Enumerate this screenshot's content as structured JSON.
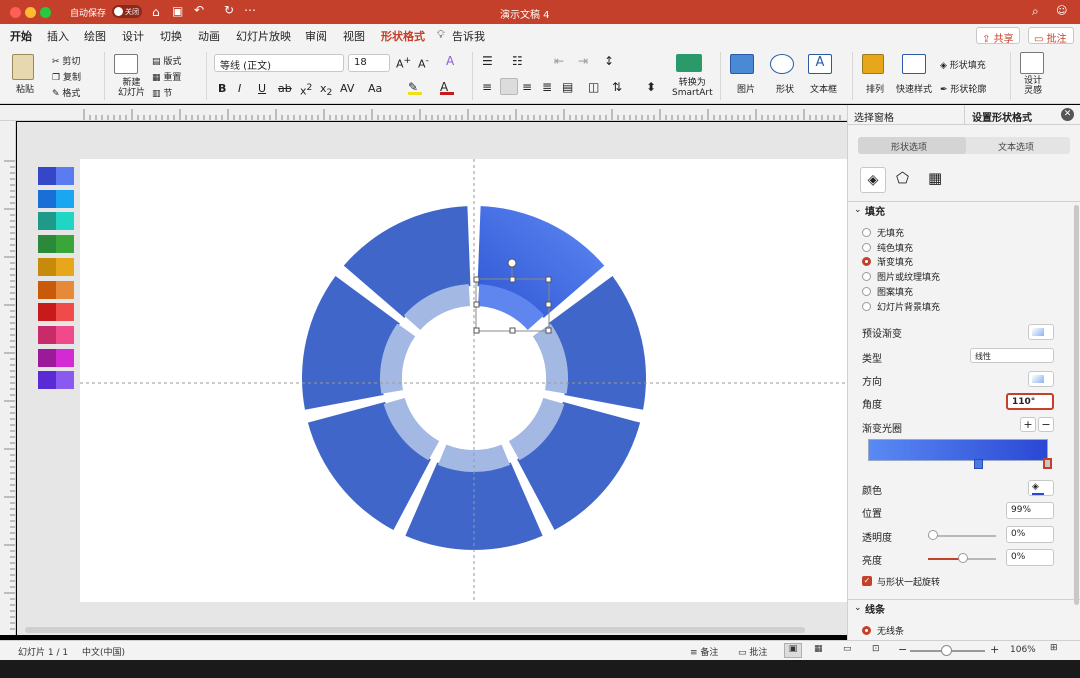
{
  "titlebar": {
    "autosave_label": "自动保存",
    "autosave_state": "关闭",
    "doc_title": "演示文稿 4"
  },
  "tabs": [
    "开始",
    "插入",
    "绘图",
    "设计",
    "切换",
    "动画",
    "幻灯片放映",
    "审阅",
    "视图",
    "形状格式",
    "告诉我"
  ],
  "tab_active": "形状格式",
  "share": {
    "share_label": "共享",
    "comment_label": "批注"
  },
  "ribbon": {
    "paste": "粘贴",
    "cut": "剪切",
    "copy": "复制",
    "format": "格式",
    "new_slide_l1": "新建",
    "new_slide_l2": "幻灯片",
    "layout": "版式",
    "reset": "重置",
    "section": "节",
    "font_name": "等线 (正文)",
    "font_size": "18",
    "convert_l1": "转换为",
    "convert_l2": "SmartArt",
    "picture": "图片",
    "shape": "形状",
    "textbox": "文本框",
    "arrange": "排列",
    "quick_styles": "快速样式",
    "shape_fill": "形状填充",
    "shape_outline": "形状轮廓",
    "designer_l1": "设计",
    "designer_l2": "灵感"
  },
  "pane": {
    "tab_selection": "选择窗格",
    "tab_format": "设置形状格式",
    "sub_shape": "形状选项",
    "sub_text": "文本选项",
    "fill_header": "填充",
    "fill_options": [
      "无填充",
      "纯色填充",
      "渐变填充",
      "图片或纹理填充",
      "图案填充",
      "幻灯片背景填充"
    ],
    "fill_selected": 2,
    "preset_gradient": "预设渐变",
    "type_label": "类型",
    "type_value": "线性",
    "direction_label": "方向",
    "angle_label": "角度",
    "angle_value": "110°",
    "stops_label": "渐变光圈",
    "color_label": "颜色",
    "position_label": "位置",
    "position_value": "99%",
    "transparency_label": "透明度",
    "transparency_value": "0%",
    "brightness_label": "亮度",
    "brightness_value": "0%",
    "rotate_with_shape": "与形状一起旋转",
    "line_header": "线条",
    "no_line": "无线条"
  },
  "swatches": [
    [
      "#3547c8",
      "#5b7bf0"
    ],
    [
      "#1a6fd6",
      "#1aa6f0"
    ],
    [
      "#1f9a8a",
      "#1fd6c4"
    ],
    [
      "#2a8a3a",
      "#3aa63a"
    ],
    [
      "#c88a0a",
      "#e6a81a"
    ],
    [
      "#c85a0a",
      "#e68a3a"
    ],
    [
      "#c81a1a",
      "#f04a4a"
    ],
    [
      "#c82a6a",
      "#f04a8a"
    ],
    [
      "#9a1a9a",
      "#d42ad4"
    ],
    [
      "#5a2ad4",
      "#8a5af0"
    ]
  ],
  "status": {
    "slide_info": "幻灯片 1 / 1",
    "language": "中文(中国)",
    "notes": "备注",
    "comments": "批注",
    "zoom": "106%"
  }
}
